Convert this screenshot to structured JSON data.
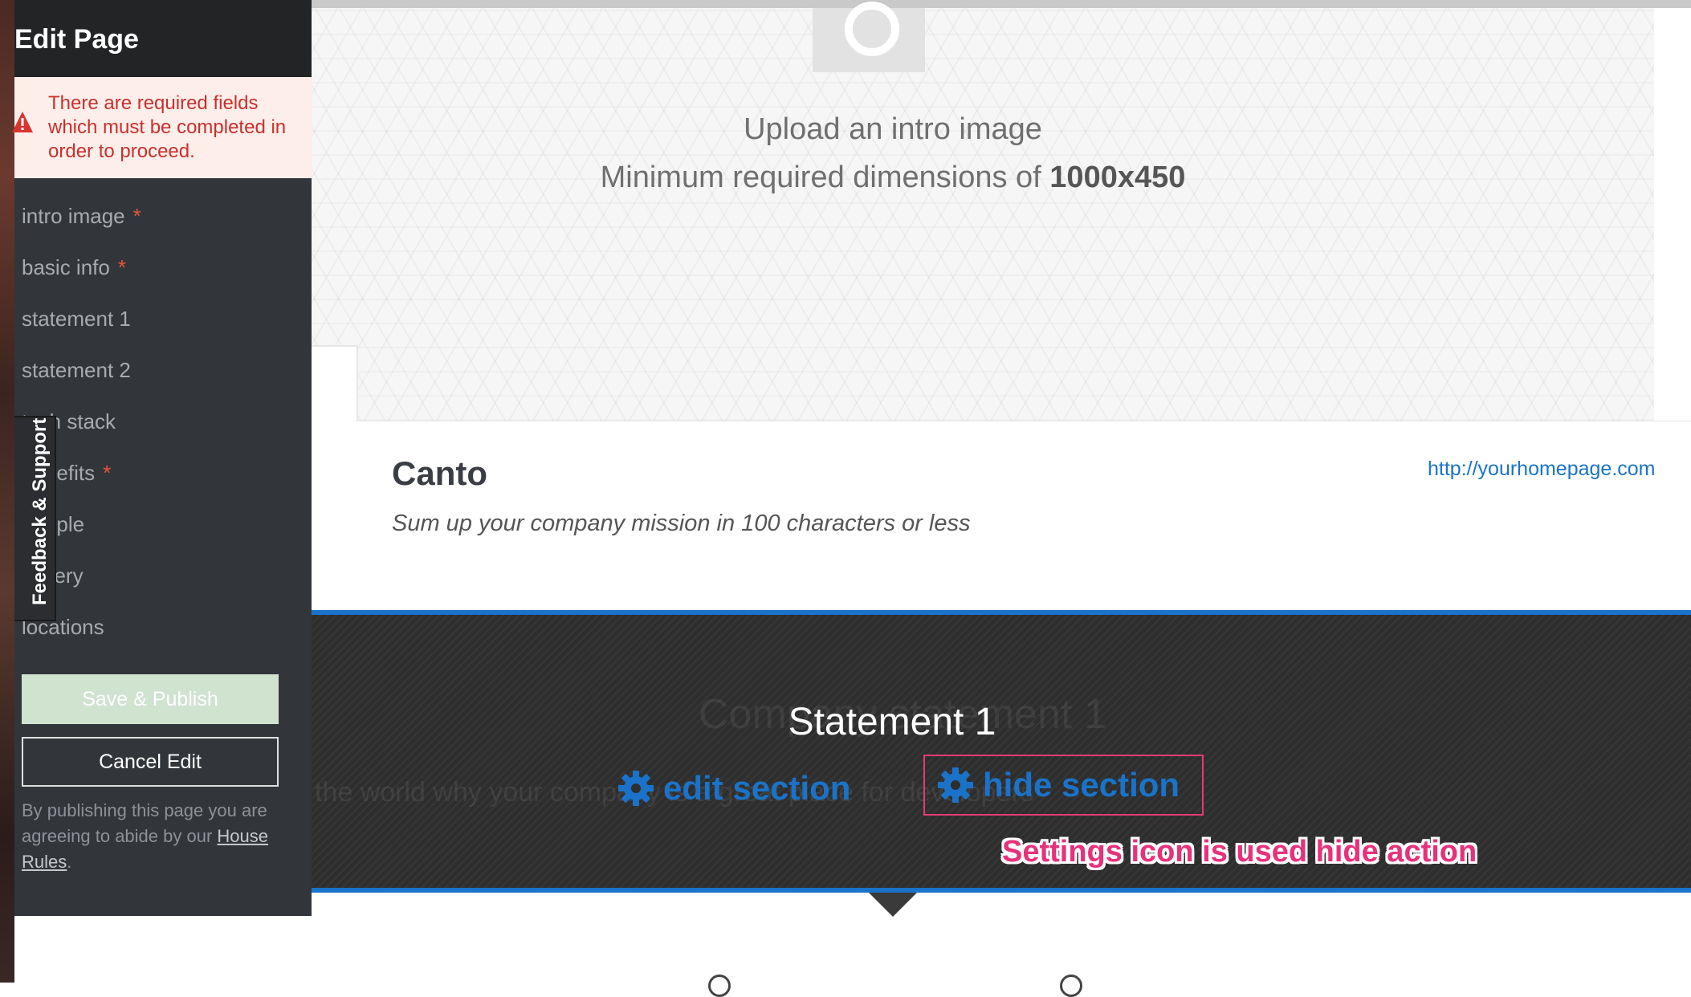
{
  "sidebar": {
    "title": "Edit Page",
    "alert": "There are required fields which must be completed in order to proceed.",
    "items": [
      {
        "label": "intro image",
        "required": "*"
      },
      {
        "label": "basic info",
        "required": "*"
      },
      {
        "label": "statement 1"
      },
      {
        "label": "statement 2"
      },
      {
        "label": "tech stack"
      },
      {
        "label": "benefits",
        "required": "*"
      },
      {
        "label": "people"
      },
      {
        "label": "gallery"
      },
      {
        "label": "locations"
      }
    ],
    "save_label": "Save & Publish",
    "cancel_label": "Cancel Edit",
    "terms_prefix": "By publishing this page you are agreeing to abide by our",
    "terms_link": "House Rules",
    "terms_suffix": "."
  },
  "feedback_tab": "Feedback & Support",
  "intro": {
    "upload_text": "Upload an intro image",
    "dims_prefix": "Minimum required dimensions of",
    "dims_value": "1000x450"
  },
  "basic_info": {
    "company_name": "Canto",
    "mission_placeholder": "Sum up your company mission in 100 characters or less",
    "homepage": "http://yourhomepage.com"
  },
  "statement": {
    "ghost_title": "Company statement 1",
    "ghost_text": "the world why your company is a great place for developers",
    "title": "Statement 1",
    "edit_label": "edit section",
    "hide_label": "hide section"
  },
  "annotation": "Settings icon is used  hide  action",
  "colors": {
    "accent": "#1a73c9",
    "annotation": "#e8317a",
    "alert_text": "#c9302c",
    "required": "#e8553a"
  },
  "icons": [
    "gear-icon",
    "warning-icon",
    "image-placeholder-icon"
  ]
}
